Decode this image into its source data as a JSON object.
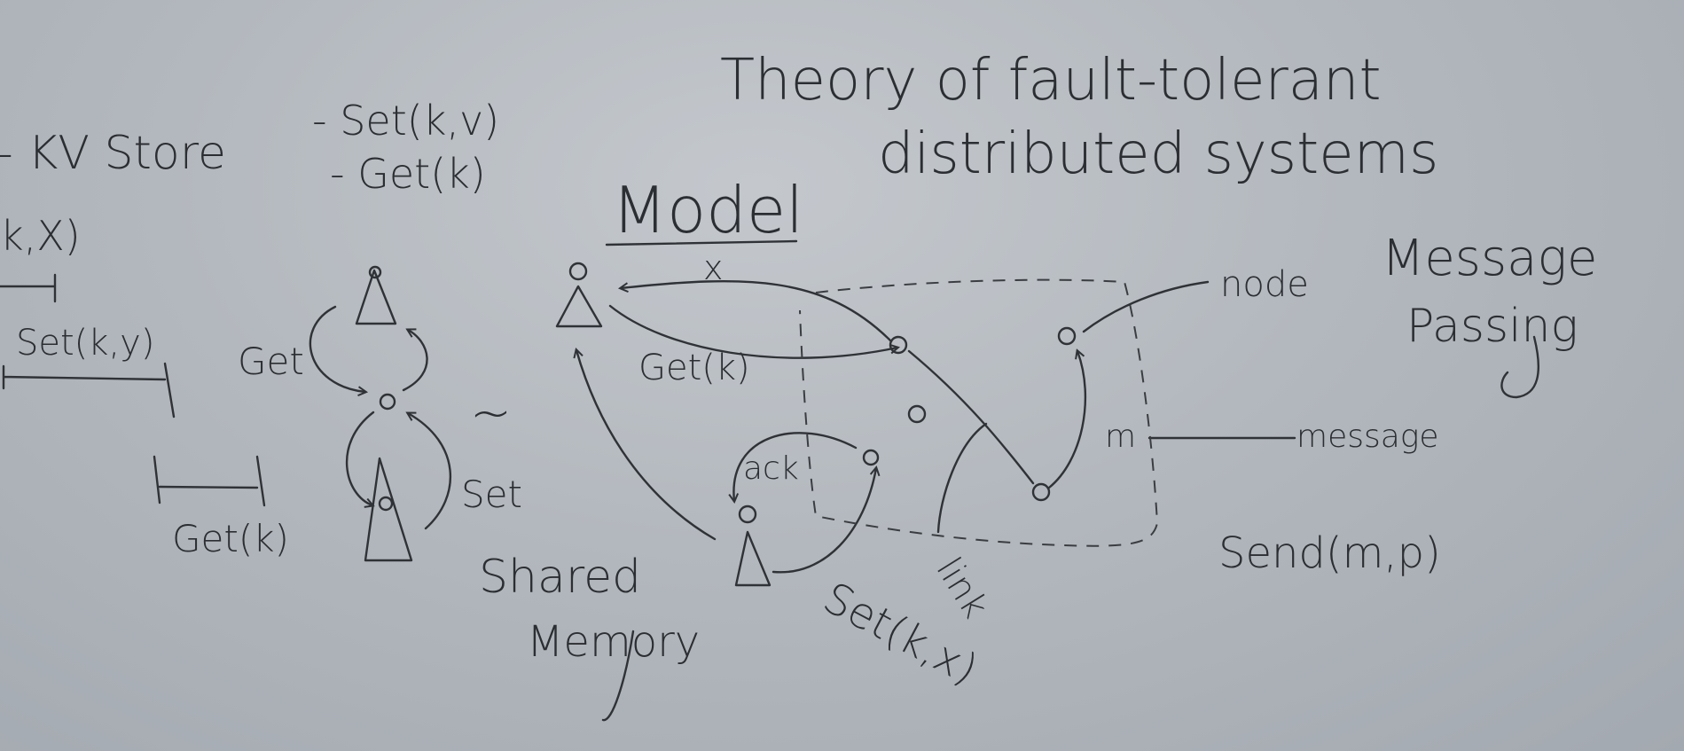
{
  "title": {
    "line1": "Theory of fault-tolerant",
    "line2": "distributed systems"
  },
  "kv": {
    "heading": "- KV Store",
    "op_set": "- Set(k,v)",
    "op_get": "- Get(k)"
  },
  "left": {
    "history_label": "(k,X)",
    "set_label": "Set(k,y)",
    "get_label": "Get(k)"
  },
  "shared_memory": {
    "get_label": "Get",
    "set_label": "Set",
    "tilde": "~",
    "caption_line1": "Shared",
    "caption_line2": "Memory"
  },
  "model": {
    "heading": "Model",
    "x_label": "x",
    "get_label": "Get(k)",
    "ack_label": "ack",
    "set_label": "Set(k,x)",
    "link_label": "link",
    "m_label": "m",
    "node_label": "node",
    "message_label": "message"
  },
  "message_passing": {
    "line1": "Message",
    "line2": "Passing",
    "send_label": "Send(m,p)"
  }
}
